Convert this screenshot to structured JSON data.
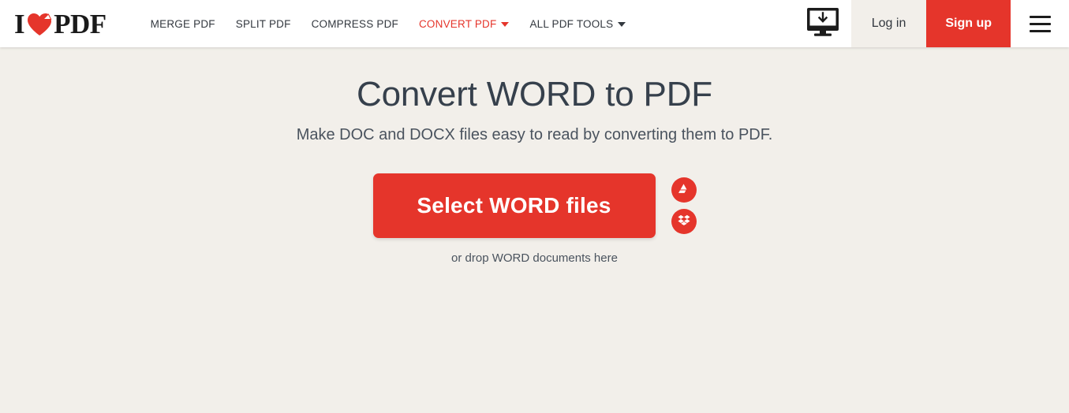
{
  "header": {
    "logo": {
      "text_left": "I",
      "text_right": "PDF",
      "heart_icon": "heart-page-fold-icon",
      "alt": "I love PDF"
    },
    "nav": [
      {
        "label": "MERGE PDF",
        "active": false,
        "has_caret": false
      },
      {
        "label": "SPLIT PDF",
        "active": false,
        "has_caret": false
      },
      {
        "label": "COMPRESS PDF",
        "active": false,
        "has_caret": false
      },
      {
        "label": "CONVERT PDF",
        "active": true,
        "has_caret": true
      },
      {
        "label": "ALL PDF TOOLS",
        "active": false,
        "has_caret": true
      }
    ],
    "desktop_icon": "desktop-download-icon",
    "login_label": "Log in",
    "signup_label": "Sign up",
    "menu_icon": "hamburger-menu-icon"
  },
  "main": {
    "title": "Convert WORD to PDF",
    "subtitle": "Make DOC and DOCX files easy to read by converting them to PDF.",
    "select_button_label": "Select WORD files",
    "cloud_buttons": [
      {
        "icon": "google-drive-icon",
        "name": "Google Drive"
      },
      {
        "icon": "dropbox-icon",
        "name": "Dropbox"
      }
    ],
    "drop_hint": "or drop WORD documents here"
  },
  "colors": {
    "brand_red": "#e5352b",
    "page_background": "#f2efea",
    "header_background": "#ffffff",
    "heading_text": "#36404c",
    "nav_text": "#33383f"
  }
}
